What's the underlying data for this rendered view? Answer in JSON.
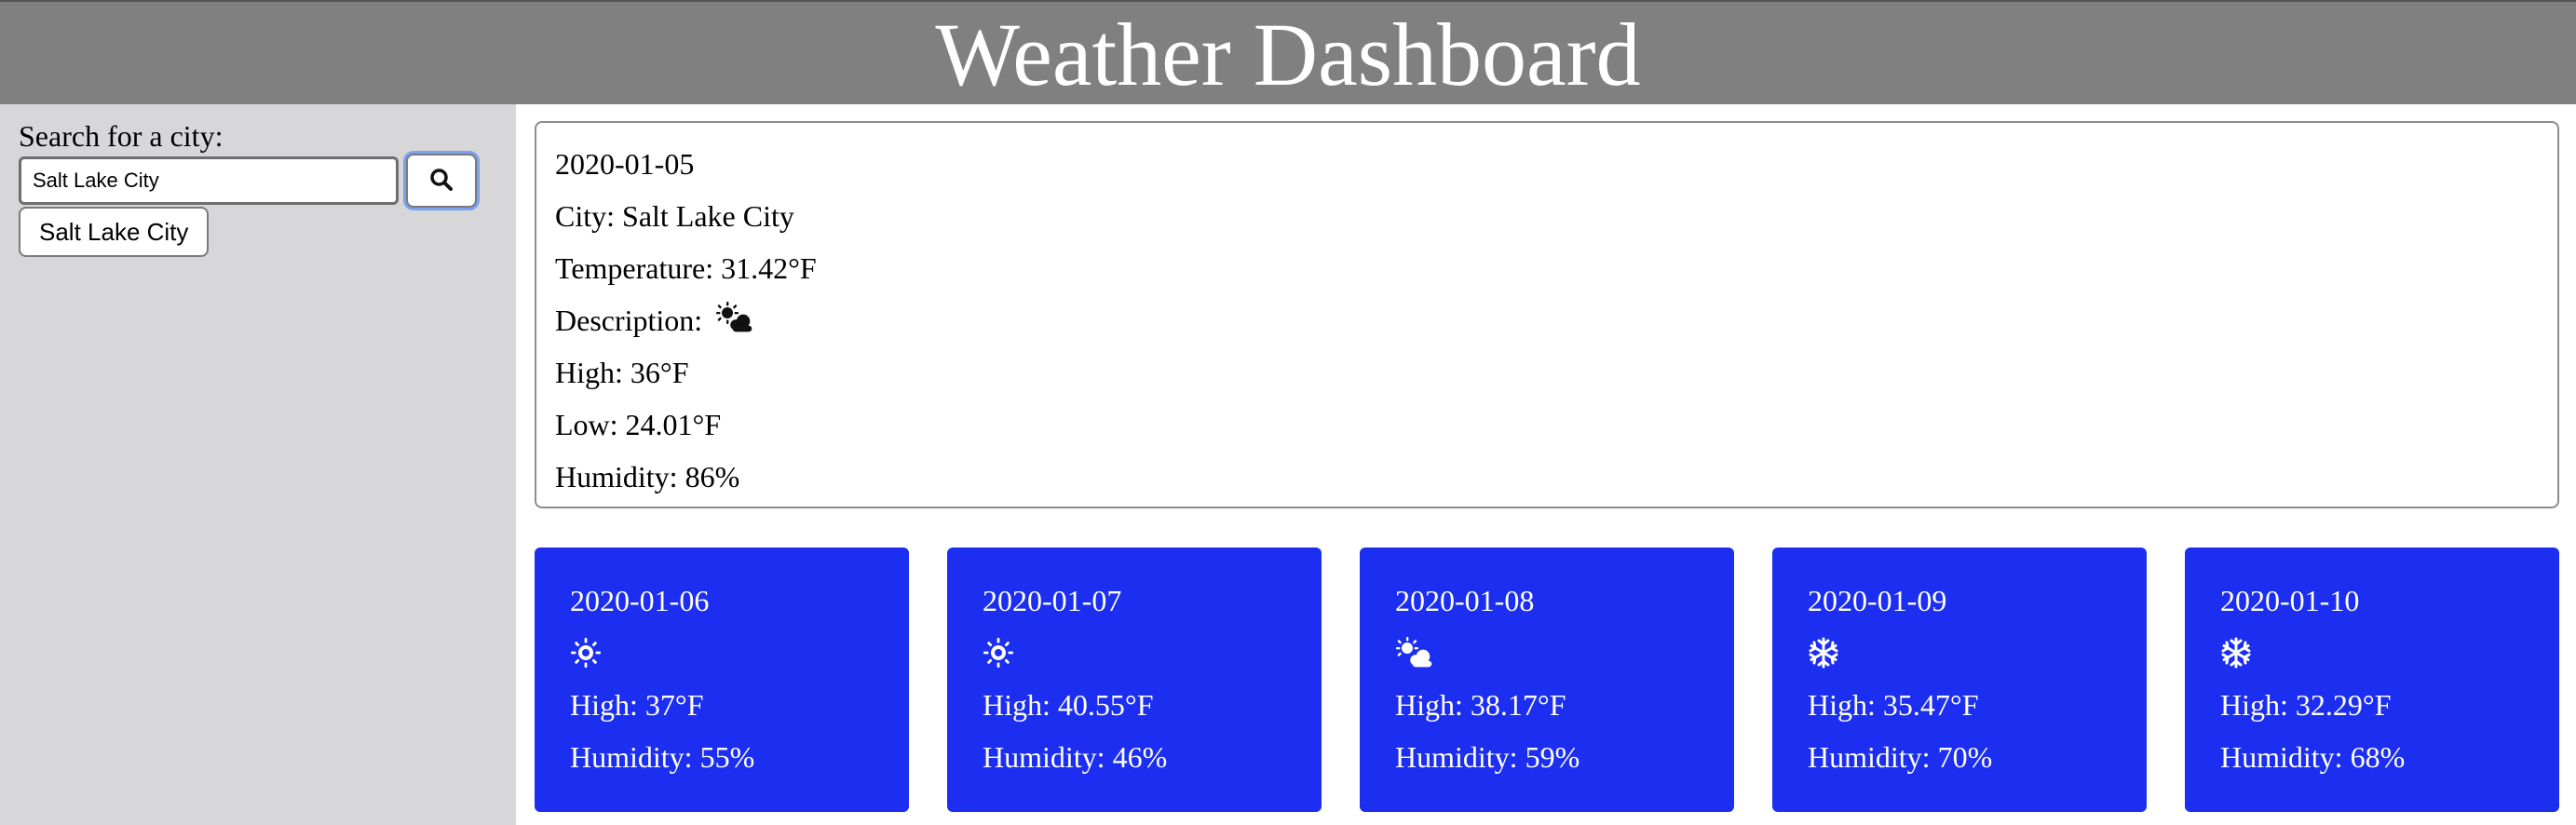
{
  "header": {
    "title": "Weather Dashboard"
  },
  "search": {
    "label": "Search for a city:",
    "input_value": "Salt Lake City",
    "button_icon": "search-icon",
    "history": [
      "Salt Lake City"
    ]
  },
  "current": {
    "date": "2020-01-05",
    "city_label": "City: Salt Lake City",
    "temperature_label": "Temperature: 31.42°F",
    "description_label": "Description:",
    "description_icon": "sun-behind-cloud-icon",
    "high_label": "High: 36°F",
    "low_label": "Low: 24.01°F",
    "humidity_label": "Humidity: 86%"
  },
  "forecast": [
    {
      "date": "2020-01-06",
      "icon": "sun-icon",
      "high_label": "High: 37°F",
      "humidity_label": "Humidity: 55%"
    },
    {
      "date": "2020-01-07",
      "icon": "sun-icon",
      "high_label": "High: 40.55°F",
      "humidity_label": "Humidity: 46%"
    },
    {
      "date": "2020-01-08",
      "icon": "sun-behind-cloud-icon",
      "high_label": "High: 38.17°F",
      "humidity_label": "Humidity: 59%"
    },
    {
      "date": "2020-01-09",
      "icon": "snowflake-icon",
      "high_label": "High: 35.47°F",
      "humidity_label": "Humidity: 70%"
    },
    {
      "date": "2020-01-10",
      "icon": "snowflake-icon",
      "high_label": "High: 32.29°F",
      "humidity_label": "Humidity: 68%"
    }
  ],
  "colors": {
    "header_bg": "#808080",
    "sidebar_bg": "#d7d6d8",
    "forecast_card_bg": "#1c2ff0",
    "focus_ring": "#7aa2ee"
  }
}
